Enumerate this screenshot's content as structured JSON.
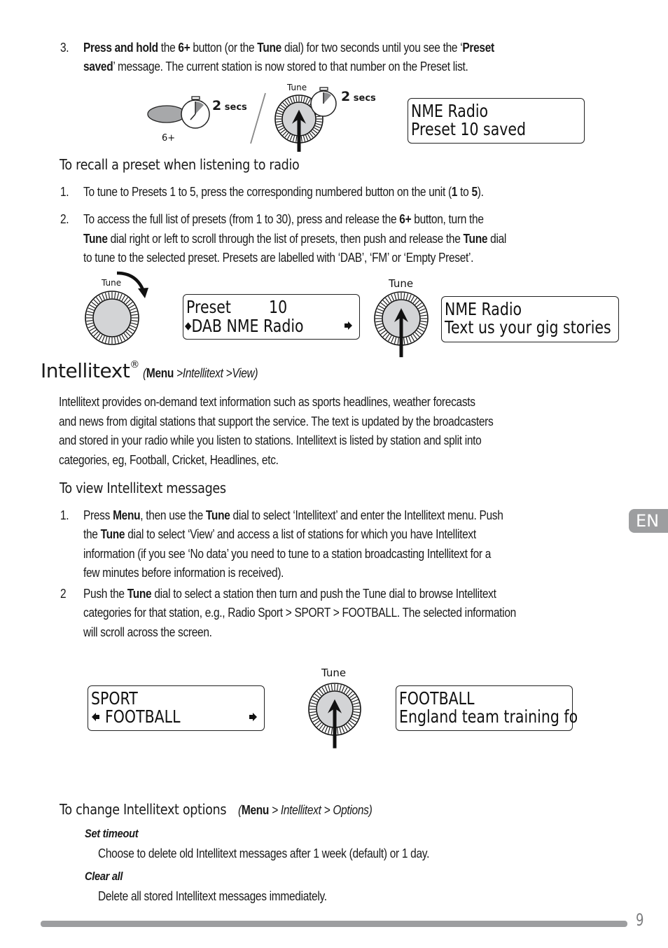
{
  "step3": {
    "number": "3.",
    "line1_parts": [
      "Press and hold",
      " the ",
      "6+",
      " button (or the ",
      "Tune",
      " dial) for two seconds until you see the ‘",
      "Preset"
    ],
    "line2_parts": [
      "saved",
      "’ message. The current station is now stored to that number on the Preset list."
    ]
  },
  "fig1": {
    "button_label": "6+",
    "timer_label_num": "2",
    "timer_label_unit": "secs",
    "dial_label": "Tune",
    "timer2_label_num": "2",
    "timer2_label_unit": "secs",
    "display": {
      "line1": "NME Radio",
      "line2": "Preset 10 saved"
    }
  },
  "recall": {
    "heading": "To recall a preset when listening to radio",
    "items": [
      {
        "number": "1.",
        "parts": [
          "To tune to Presets 1 to 5, press the corresponding numbered button on the unit (",
          "1",
          " to ",
          "5",
          ")."
        ]
      },
      {
        "number": "2.",
        "line1_parts": [
          "To access the full list of presets (from 1 to 30), press and release the ",
          "6+",
          " button, turn the"
        ],
        "line2_parts": [
          "Tune",
          " dial right or left to scroll through the list of presets, then push and release the ",
          "Tune",
          " dial"
        ],
        "line3": "to tune to the selected preset. Presets are labelled with ‘DAB’, ‘FM’ or ‘Empty Preset’."
      }
    ]
  },
  "fig2": {
    "dial1_label": "Tune",
    "display1": {
      "line1_a": "Preset",
      "line1_b": "10",
      "line2": "DAB NME Radio"
    },
    "dial2_label": "Tune",
    "display2": {
      "line1": "NME Radio",
      "line2": "Text us your gig stories"
    }
  },
  "intellitext": {
    "title": "Intellitext",
    "reg": "®",
    "path_open": "(",
    "path_menu": "Menu",
    "path_rest": " >Intellitext  >View)",
    "body": [
      "Intellitext provides on-demand text information such as sports headlines, weather forecasts",
      "and news from digital stations that support the service. The text is updated by the broadcasters",
      "and stored in your radio while you listen to stations. Intellitext is listed by station and split into",
      "categories, eg, Football, Cricket, Headlines, etc."
    ]
  },
  "view": {
    "heading": "To view Intellitext messages",
    "items": [
      {
        "number": "1.",
        "line1_parts": [
          "Press ",
          "Menu",
          ", then use the ",
          "Tune",
          " dial to select ‘Intellitext’ and enter the Intellitext menu. Push"
        ],
        "line2_parts": [
          "the ",
          "Tune",
          " dial to select ‘View’ and access a list of stations for which you have Intellitext"
        ],
        "line3": "information (if you see ‘No data’ you need to tune to a station broadcasting Intellitext for a",
        "line4": "few minutes before information is received)."
      },
      {
        "number": "2",
        "line1_parts": [
          "Push the ",
          "Tune",
          " dial to select a station then turn and push the Tune dial to browse Intellitext"
        ],
        "line2": "categories for that station, e.g., Radio Sport > SPORT > FOOTBALL. The selected information",
        "line3": "will scroll across the screen."
      }
    ]
  },
  "fig3": {
    "display1": {
      "line1": "SPORT",
      "line2": "FOOTBALL"
    },
    "dial_label": "Tune",
    "display2": {
      "line1": "FOOTBALL",
      "line2": "England team training fo"
    }
  },
  "options": {
    "heading": "To change Intellitext options",
    "path_open": "(",
    "path_menu": "Menu",
    "path_rest": " > Intellitext > Options)",
    "items": [
      {
        "title": "Set timeout",
        "desc": "Choose to delete old Intellitext messages after 1 week (default) or 1 day."
      },
      {
        "title": "Clear all",
        "desc": "Delete all stored Intellitext messages immediately."
      }
    ]
  },
  "footer": {
    "language_tab": "EN",
    "page_number": "9"
  },
  "colors": {
    "text": "#1a1a1a",
    "grey_accent": "#9d9ea0",
    "dial_fill": "#d3d4d6",
    "button_fill": "#a7a8aa"
  }
}
